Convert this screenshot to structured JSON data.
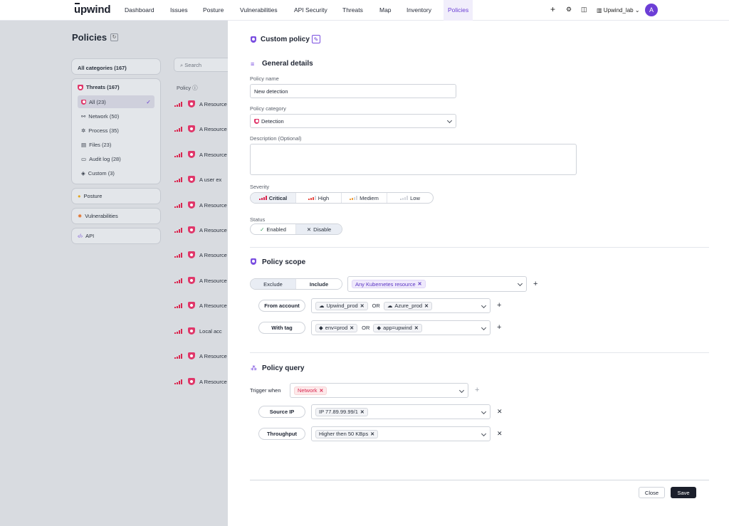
{
  "nav": {
    "logo": "upwind",
    "items": [
      "Dashboard",
      "Issues",
      "Posture",
      "Vulnerabilities",
      "API Security",
      "Threats",
      "Map",
      "Inventory",
      "Policies"
    ],
    "active": "Policies",
    "tenant": "Upwind_lab",
    "avatar_letter": "A"
  },
  "left": {
    "page_title": "Policies",
    "all_categories": "All categories (167)",
    "threats_label": "Threats (167)",
    "sub_items": [
      "All (23)",
      "Network (50)",
      "Process (35)",
      "Files (23)",
      "Audit log (28)",
      "Custom (3)"
    ],
    "posture": "Posture",
    "vulnerabilities": "Vulnerabilities",
    "api": "API",
    "search_placeholder": "Search",
    "col_policy": "Policy",
    "rows": [
      "A Resource",
      "A Resource",
      "A Resource",
      "A user ex",
      "A Resource",
      "A Resource",
      "A Resource",
      "A Resource",
      "A Resource",
      "Local acc",
      "A Resource",
      "A Resource"
    ]
  },
  "panel": {
    "title": "Custom policy",
    "general": {
      "title": "General details",
      "name_label": "Policy name",
      "name_value": "New detection",
      "category_label": "Policy category",
      "category_value": "Detection",
      "desc_label": "Description (Optional)",
      "severity_label": "Severity",
      "severity_options": [
        "Critical",
        "High",
        "Mediem",
        "Low"
      ],
      "status_label": "Status",
      "status_options": [
        "Enabled",
        "Disable"
      ]
    },
    "scope": {
      "title": "Policy scope",
      "exclude": "Exclude",
      "include": "Include",
      "resource_chip": "Any Kubernetes resource",
      "from_account": "From account",
      "account_chips": [
        "Upwind_prod",
        "Azure_prod"
      ],
      "or": "OR",
      "with_tag": "With tag",
      "tag_chips": [
        "env=prod",
        "app=upwind"
      ]
    },
    "query": {
      "title": "Policy query",
      "trigger_label": "Trigger when",
      "trigger_chip": "Network",
      "source_ip": "Source IP",
      "source_ip_chip": "IP 77.89.99.99/1",
      "throughput": "Throughput",
      "throughput_chip": "Higher then 50 KBps"
    },
    "close": "Close",
    "save": "Save"
  },
  "colors": {
    "accent": "#6b3fd4",
    "critical": "#d9264f",
    "high": "#e8483f",
    "medium": "#f0a03a",
    "low": "#c9ccd3"
  }
}
